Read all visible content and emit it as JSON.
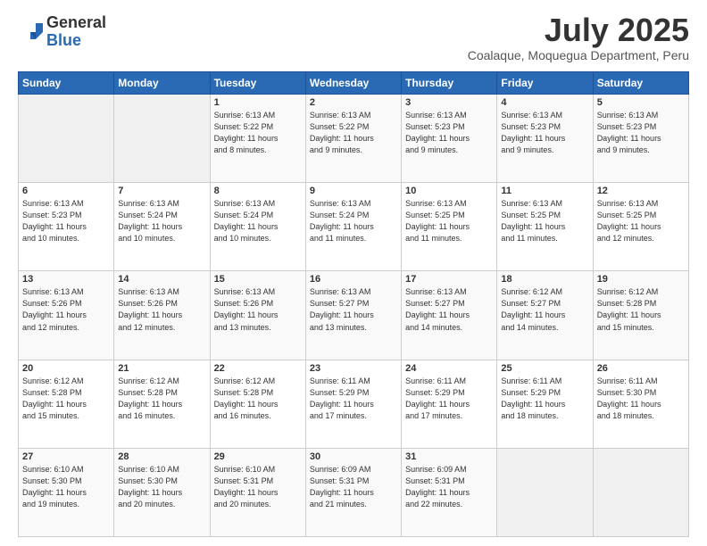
{
  "header": {
    "logo_general": "General",
    "logo_blue": "Blue",
    "month_title": "July 2025",
    "location": "Coalaque, Moquegua Department, Peru"
  },
  "weekdays": [
    "Sunday",
    "Monday",
    "Tuesday",
    "Wednesday",
    "Thursday",
    "Friday",
    "Saturday"
  ],
  "weeks": [
    [
      {
        "day": "",
        "info": ""
      },
      {
        "day": "",
        "info": ""
      },
      {
        "day": "1",
        "info": "Sunrise: 6:13 AM\nSunset: 5:22 PM\nDaylight: 11 hours\nand 8 minutes."
      },
      {
        "day": "2",
        "info": "Sunrise: 6:13 AM\nSunset: 5:22 PM\nDaylight: 11 hours\nand 9 minutes."
      },
      {
        "day": "3",
        "info": "Sunrise: 6:13 AM\nSunset: 5:23 PM\nDaylight: 11 hours\nand 9 minutes."
      },
      {
        "day": "4",
        "info": "Sunrise: 6:13 AM\nSunset: 5:23 PM\nDaylight: 11 hours\nand 9 minutes."
      },
      {
        "day": "5",
        "info": "Sunrise: 6:13 AM\nSunset: 5:23 PM\nDaylight: 11 hours\nand 9 minutes."
      }
    ],
    [
      {
        "day": "6",
        "info": "Sunrise: 6:13 AM\nSunset: 5:23 PM\nDaylight: 11 hours\nand 10 minutes."
      },
      {
        "day": "7",
        "info": "Sunrise: 6:13 AM\nSunset: 5:24 PM\nDaylight: 11 hours\nand 10 minutes."
      },
      {
        "day": "8",
        "info": "Sunrise: 6:13 AM\nSunset: 5:24 PM\nDaylight: 11 hours\nand 10 minutes."
      },
      {
        "day": "9",
        "info": "Sunrise: 6:13 AM\nSunset: 5:24 PM\nDaylight: 11 hours\nand 11 minutes."
      },
      {
        "day": "10",
        "info": "Sunrise: 6:13 AM\nSunset: 5:25 PM\nDaylight: 11 hours\nand 11 minutes."
      },
      {
        "day": "11",
        "info": "Sunrise: 6:13 AM\nSunset: 5:25 PM\nDaylight: 11 hours\nand 11 minutes."
      },
      {
        "day": "12",
        "info": "Sunrise: 6:13 AM\nSunset: 5:25 PM\nDaylight: 11 hours\nand 12 minutes."
      }
    ],
    [
      {
        "day": "13",
        "info": "Sunrise: 6:13 AM\nSunset: 5:26 PM\nDaylight: 11 hours\nand 12 minutes."
      },
      {
        "day": "14",
        "info": "Sunrise: 6:13 AM\nSunset: 5:26 PM\nDaylight: 11 hours\nand 12 minutes."
      },
      {
        "day": "15",
        "info": "Sunrise: 6:13 AM\nSunset: 5:26 PM\nDaylight: 11 hours\nand 13 minutes."
      },
      {
        "day": "16",
        "info": "Sunrise: 6:13 AM\nSunset: 5:27 PM\nDaylight: 11 hours\nand 13 minutes."
      },
      {
        "day": "17",
        "info": "Sunrise: 6:13 AM\nSunset: 5:27 PM\nDaylight: 11 hours\nand 14 minutes."
      },
      {
        "day": "18",
        "info": "Sunrise: 6:12 AM\nSunset: 5:27 PM\nDaylight: 11 hours\nand 14 minutes."
      },
      {
        "day": "19",
        "info": "Sunrise: 6:12 AM\nSunset: 5:28 PM\nDaylight: 11 hours\nand 15 minutes."
      }
    ],
    [
      {
        "day": "20",
        "info": "Sunrise: 6:12 AM\nSunset: 5:28 PM\nDaylight: 11 hours\nand 15 minutes."
      },
      {
        "day": "21",
        "info": "Sunrise: 6:12 AM\nSunset: 5:28 PM\nDaylight: 11 hours\nand 16 minutes."
      },
      {
        "day": "22",
        "info": "Sunrise: 6:12 AM\nSunset: 5:28 PM\nDaylight: 11 hours\nand 16 minutes."
      },
      {
        "day": "23",
        "info": "Sunrise: 6:11 AM\nSunset: 5:29 PM\nDaylight: 11 hours\nand 17 minutes."
      },
      {
        "day": "24",
        "info": "Sunrise: 6:11 AM\nSunset: 5:29 PM\nDaylight: 11 hours\nand 17 minutes."
      },
      {
        "day": "25",
        "info": "Sunrise: 6:11 AM\nSunset: 5:29 PM\nDaylight: 11 hours\nand 18 minutes."
      },
      {
        "day": "26",
        "info": "Sunrise: 6:11 AM\nSunset: 5:30 PM\nDaylight: 11 hours\nand 18 minutes."
      }
    ],
    [
      {
        "day": "27",
        "info": "Sunrise: 6:10 AM\nSunset: 5:30 PM\nDaylight: 11 hours\nand 19 minutes."
      },
      {
        "day": "28",
        "info": "Sunrise: 6:10 AM\nSunset: 5:30 PM\nDaylight: 11 hours\nand 20 minutes."
      },
      {
        "day": "29",
        "info": "Sunrise: 6:10 AM\nSunset: 5:31 PM\nDaylight: 11 hours\nand 20 minutes."
      },
      {
        "day": "30",
        "info": "Sunrise: 6:09 AM\nSunset: 5:31 PM\nDaylight: 11 hours\nand 21 minutes."
      },
      {
        "day": "31",
        "info": "Sunrise: 6:09 AM\nSunset: 5:31 PM\nDaylight: 11 hours\nand 22 minutes."
      },
      {
        "day": "",
        "info": ""
      },
      {
        "day": "",
        "info": ""
      }
    ]
  ]
}
